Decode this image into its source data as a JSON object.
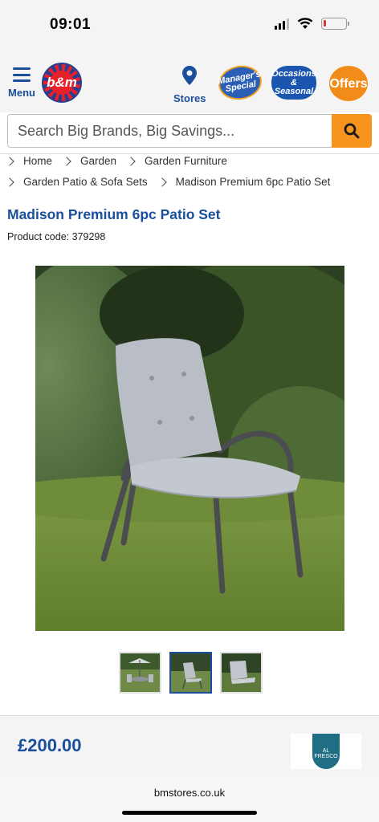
{
  "status_bar": {
    "time": "09:01"
  },
  "header": {
    "menu_label": "Menu",
    "logo_text": "b&m",
    "stores_label": "Stores",
    "badges": {
      "managers_special": "Manager's Special",
      "occasions_seasonal": "Occasions & Seasonal",
      "offers": "Offers"
    },
    "colors": {
      "brand_blue": "#1a4f9c",
      "accent_orange": "#f7941d"
    }
  },
  "search": {
    "placeholder": "Search Big Brands, Big Savings..."
  },
  "breadcrumb": {
    "row1": [
      "Home",
      "Garden",
      "Garden Furniture"
    ],
    "row2": [
      "Garden Patio & Sofa Sets",
      "Madison Premium 6pc Patio Set"
    ]
  },
  "product": {
    "title": "Madison Premium 6pc Patio Set",
    "code_label": "Product code:",
    "code": "379298",
    "price": "£200.00",
    "brand_badge": "AL FRESCO",
    "thumbnails": [
      {
        "name": "patio-set-thumb",
        "active": false
      },
      {
        "name": "chair-thumb",
        "active": true
      },
      {
        "name": "cushion-thumb",
        "active": false
      }
    ]
  },
  "browser": {
    "url": "bmstores.co.uk"
  }
}
